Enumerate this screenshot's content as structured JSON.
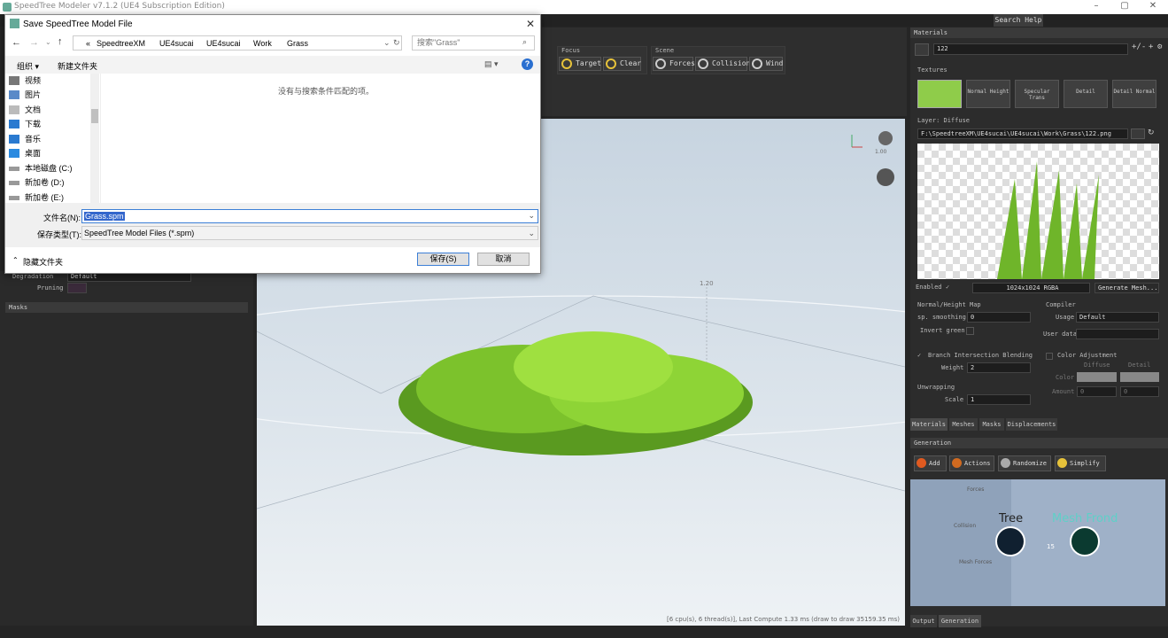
{
  "app": {
    "title": "SpeedTree Modeler v7.1.2 (UE4 Subscription Edition)",
    "help_menu": "Search Help"
  },
  "toolbar": {
    "focus_label": "Focus",
    "target": "Target",
    "clear": "Clear",
    "scene_label": "Scene",
    "forces": "Forces",
    "collision": "Collision",
    "wind": "Wind"
  },
  "viewport": {
    "status": "[6 cpu(s), 6 thread(s)], Last Compute 1.33 ms (draw to draw 35159.35 ms)",
    "scale1": "1.00",
    "scale2": "1.20"
  },
  "left": {
    "degradation_label": "Degradation",
    "degradation_value": "Default",
    "pruning_label": "Pruning",
    "masks_label": "Masks"
  },
  "materials": {
    "header": "Materials",
    "selected": "122",
    "textures_label": "Textures",
    "textures": [
      "Normal Height",
      "Specular Trans",
      "Detail",
      "Detail Normal"
    ],
    "layer_label": "Layer: Diffuse",
    "path": "F:\\SpeedtreeXM\\UE4sucai\\UE4sucai\\Work\\Grass\\122.png",
    "enabled_label": "Enabled",
    "resolution": "1024x1024  RGBA",
    "generate_mesh": "Generate Mesh...",
    "normal_map_label": "Normal/Height Map",
    "smoothing_label": "sp. smoothing",
    "smoothing_value": "0",
    "invert_green": "Invert green",
    "compiler_label": "Compiler",
    "usage_label": "Usage",
    "usage_value": "Default",
    "user_data_label": "User data",
    "branch_blending": "Branch Intersection Blending",
    "weight_label": "Weight",
    "weight_value": "2",
    "color_adjust": "Color Adjustment",
    "diffuse_col": "Diffuse",
    "detail_col": "Detail",
    "color_label": "Color",
    "amount_label": "Amount",
    "amount1": "0",
    "amount2": "0",
    "unwrapping_label": "Unwrapping",
    "scale_label": "Scale",
    "scale_value": "1"
  },
  "right_tabs": [
    "Materials",
    "Meshes",
    "Masks",
    "Displacements"
  ],
  "generation": {
    "header": "Generation",
    "add": "Add",
    "actions": "Actions",
    "randomize": "Randomize",
    "simplify": "Simplify",
    "forces": "Forces",
    "collision": "Collision",
    "mesh_forces": "Mesh Forces",
    "tree": "Tree",
    "mesh_frond": "Mesh Frond",
    "edge_count": "15"
  },
  "bottom_tabs": [
    "Output",
    "Generation"
  ],
  "dialog": {
    "title": "Save SpeedTree Model File",
    "breadcrumbs": [
      "«",
      "SpeedtreeXM",
      "UE4sucai",
      "UE4sucai",
      "Work",
      "Grass"
    ],
    "search_placeholder": "搜索\"Grass\"",
    "organize": "组织 ▾",
    "new_folder": "新建文件夹",
    "nav_items": [
      "视频",
      "图片",
      "文档",
      "下载",
      "音乐",
      "桌面",
      "本地磁盘 (C:)",
      "新加卷 (D:)",
      "新加卷 (E:)"
    ],
    "empty_message": "没有与搜索条件匹配的项。",
    "filename_label": "文件名(N):",
    "filename_value": "Grass.spm",
    "filetype_label": "保存类型(T):",
    "filetype_value": "SpeedTree Model Files (*.spm)",
    "hide_folders": "隐藏文件夹",
    "save": "保存(S)",
    "cancel": "取消"
  }
}
